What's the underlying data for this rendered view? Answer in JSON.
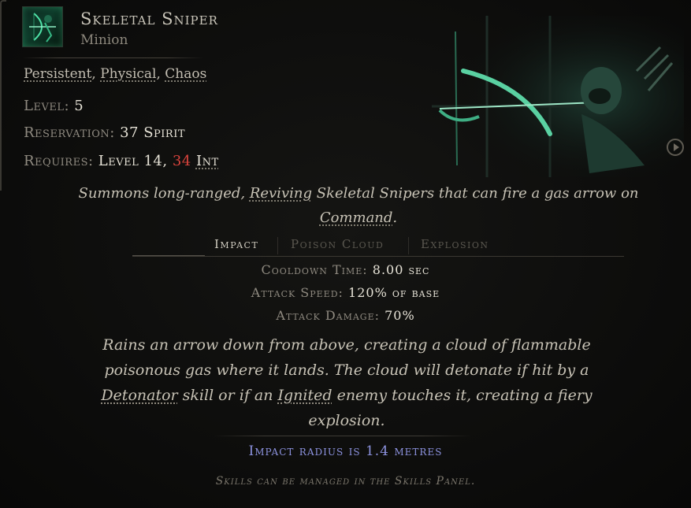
{
  "skill": {
    "name": "Skeletal Sniper",
    "type": "Minion",
    "tags": [
      "Persistent",
      "Physical",
      "Chaos"
    ],
    "level_label": "Level:",
    "level_value": "5",
    "reservation_label": "Reservation:",
    "reservation_value": "37 Spirit",
    "requires_label": "Requires:",
    "requires_level": "Level 14,",
    "requires_int_value": "34",
    "requires_int_label": "Int"
  },
  "description": {
    "pre": "Summons long-ranged, ",
    "kw1": "Reviving",
    "mid": " Skeletal Snipers that can fire a gas arrow on ",
    "kw2": "Command",
    "post": "."
  },
  "tabs": [
    {
      "label": "Impact",
      "active": true
    },
    {
      "label": "Poison Cloud",
      "active": false
    },
    {
      "label": "Explosion",
      "active": false
    }
  ],
  "stats": [
    {
      "label": "Cooldown Time:",
      "value": "8.00 sec"
    },
    {
      "label": "Attack Speed:",
      "value": "120% of base"
    },
    {
      "label": "Attack Damage:",
      "value": "70%"
    }
  ],
  "effect": {
    "p1": "Rains an arrow down from above, creating a cloud of flammable poisonous gas where it lands. The cloud will detonate if hit by a ",
    "kw1": "Detonator",
    "p2": " skill or if an ",
    "kw2": "Ignited",
    "p3": " enemy touches it, creating a fiery explosion."
  },
  "radius_text": "Impact radius is 1.4 metres",
  "footer_text": "Skills can be managed in the Skills Panel.",
  "icons": {
    "gem": "skeletal-sniper-gem-icon",
    "play": "play-circle-icon"
  },
  "colors": {
    "accent_green": "#3fe0a0",
    "requirement_red": "#d9433c",
    "radius_blue": "#8d93e0"
  }
}
